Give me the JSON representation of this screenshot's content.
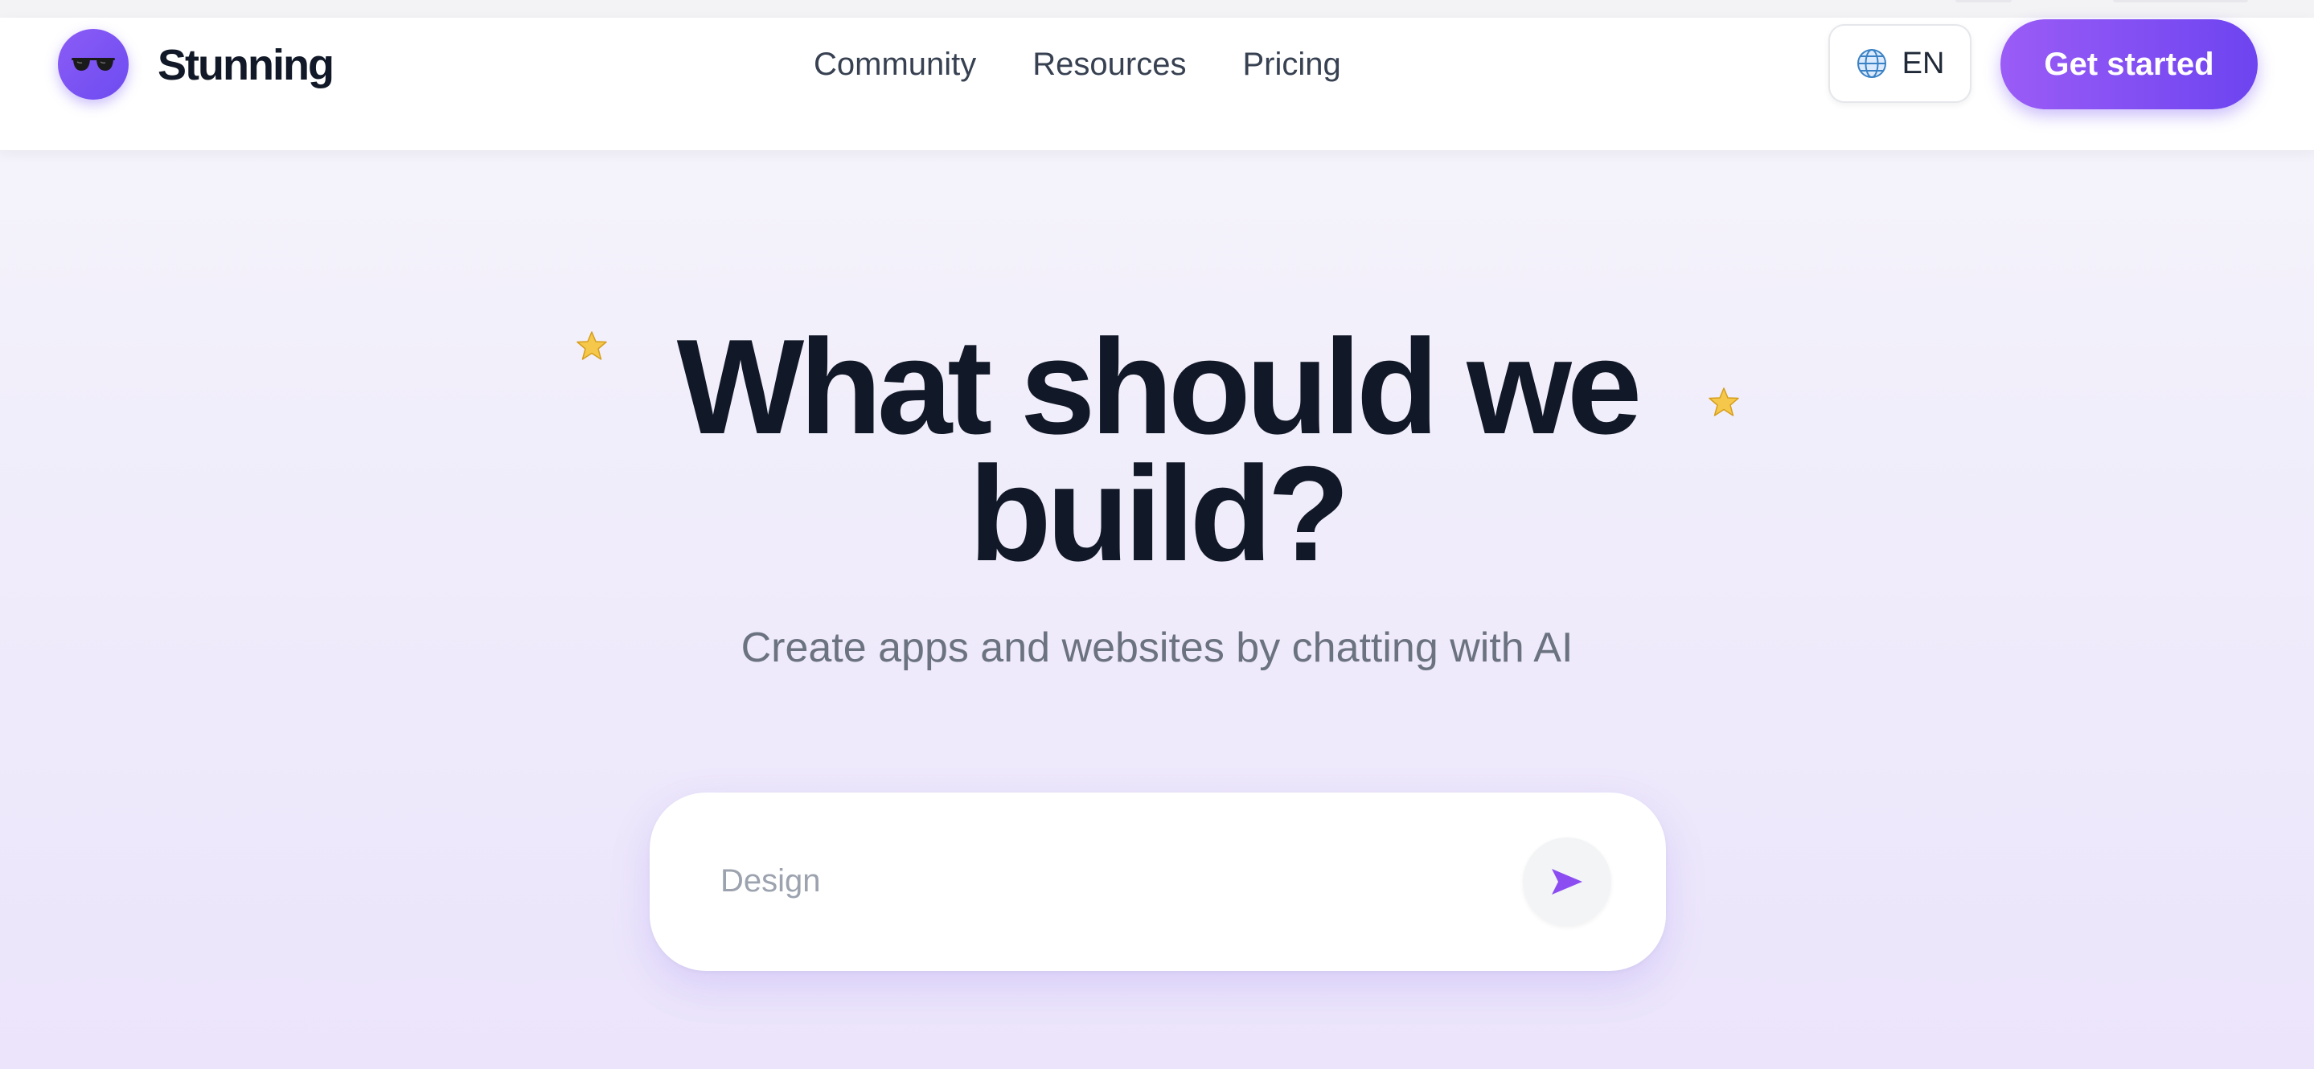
{
  "header": {
    "brand": "Stunning",
    "nav": [
      "Community",
      "Resources",
      "Pricing"
    ],
    "language": "EN",
    "cta_label": "Get started"
  },
  "hero": {
    "title_line1": "What should we",
    "title_line2": "build?",
    "subtitle": "Create apps and websites by chatting with AI"
  },
  "prompt": {
    "placeholder": "Design"
  },
  "icons": {
    "logo": "sunglasses-icon",
    "language": "globe-icon",
    "send": "send-arrow-icon",
    "decoration": "star-icon"
  },
  "colors": {
    "accent": "#7c4df2",
    "accent_light": "#9b5cf6",
    "title": "#111827",
    "subtitle": "#6b7280",
    "star": "#f5c84c"
  }
}
